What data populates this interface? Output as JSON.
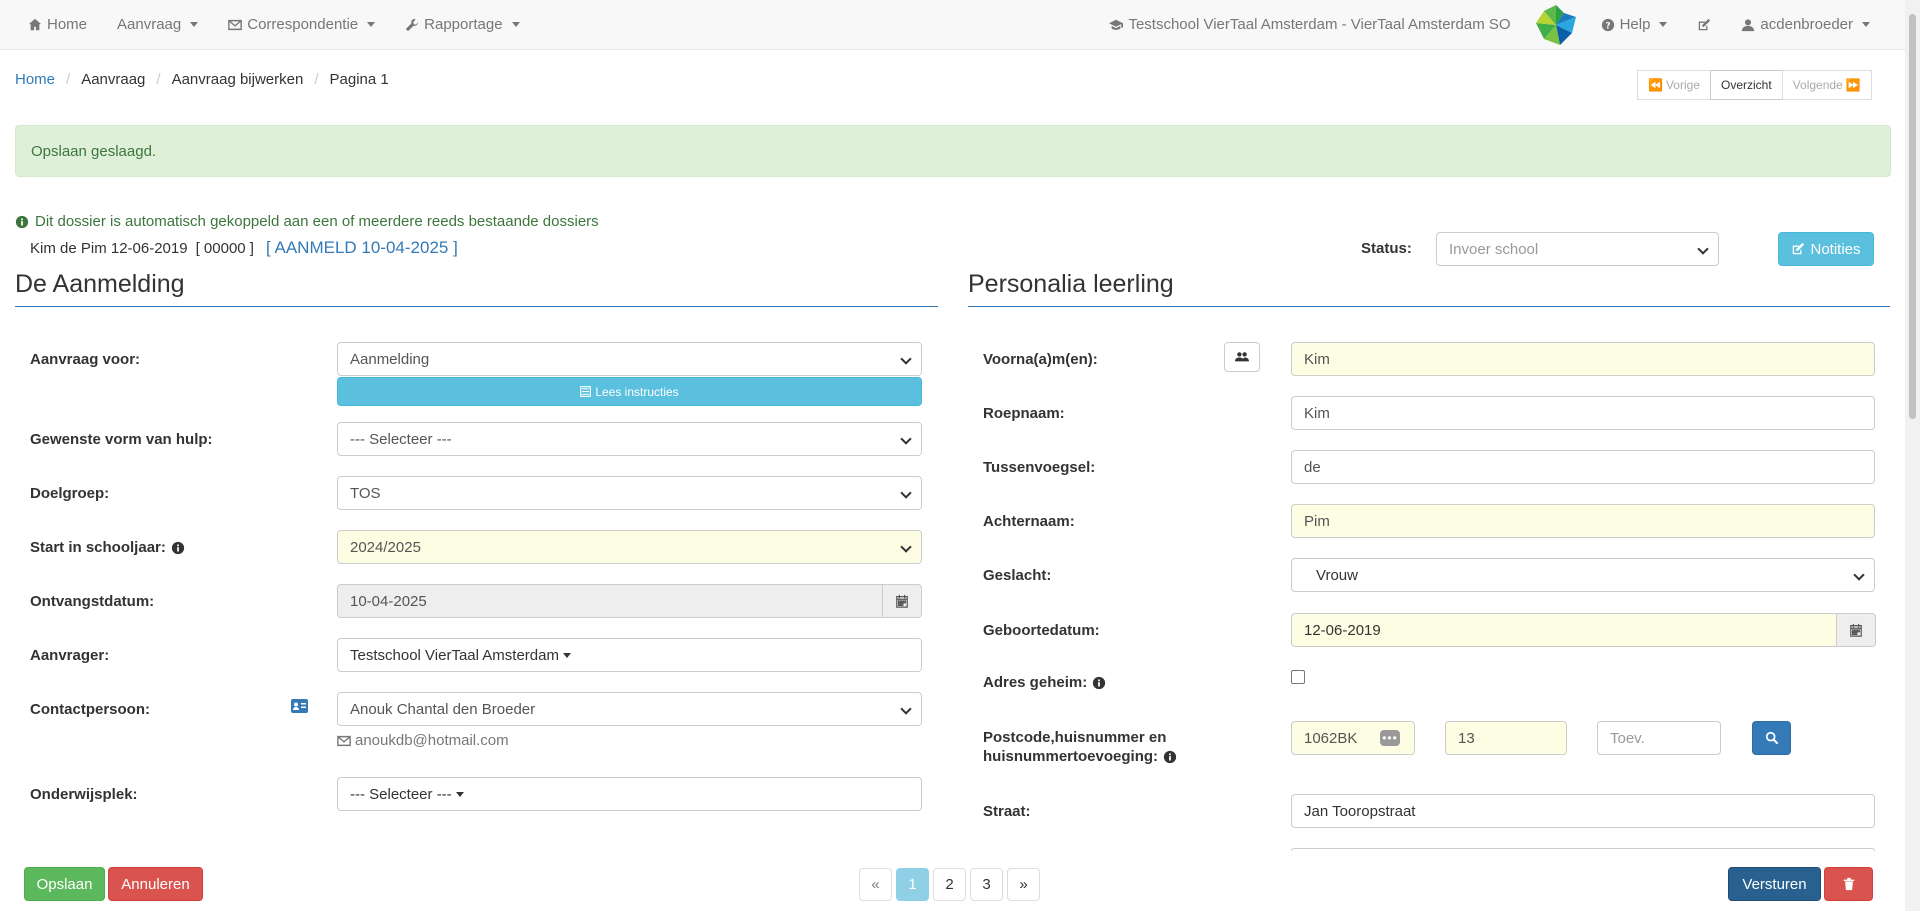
{
  "nav": {
    "home": "Home",
    "aanvraag": "Aanvraag",
    "correspondentie": "Correspondentie",
    "rapportage": "Rapportage",
    "school": "Testschool VierTaal Amsterdam - VierTaal Amsterdam SO",
    "help": "Help",
    "user": "acdenbroeder"
  },
  "breadcrumb": {
    "home": "Home",
    "aanvraag": "Aanvraag",
    "bijwerken": "Aanvraag bijwerken",
    "pagina": "Pagina 1"
  },
  "pager_top": {
    "vorige": "Vorige",
    "overzicht": "Overzicht",
    "volgende": "Volgende"
  },
  "alert_success": "Opslaan geslaagd.",
  "link_notice": "Dit dossier is automatisch gekoppeld aan een of meerdere reeds bestaande dossiers",
  "dossier": {
    "name": "Kim de Pim 12-06-2019",
    "code": "[ 00000 ]",
    "ref": "[ AANMELD 10-04-2025 ]"
  },
  "status": {
    "label": "Status:",
    "value": "Invoer school"
  },
  "notities_label": "Notities",
  "aanmelding": {
    "title": "De Aanmelding",
    "aanvraag_voor": {
      "label": "Aanvraag voor:",
      "value": "Aanmelding"
    },
    "instructies_label": "Lees instructies",
    "vorm_hulp": {
      "label": "Gewenste vorm van hulp:",
      "value": "--- Selecteer ---"
    },
    "doelgroep": {
      "label": "Doelgroep:",
      "value": "TOS"
    },
    "schooljaar": {
      "label": "Start in schooljaar:",
      "value": "2024/2025"
    },
    "ontvangst": {
      "label": "Ontvangstdatum:",
      "value": "10-04-2025"
    },
    "aanvrager": {
      "label": "Aanvrager:",
      "value": "Testschool VierTaal Amsterdam"
    },
    "contact": {
      "label": "Contactpersoon:",
      "value": "Anouk Chantal den Broeder",
      "email": "anoukdb@hotmail.com"
    },
    "onderwijsplek": {
      "label": "Onderwijsplek:",
      "value": "--- Selecteer ---"
    }
  },
  "personalia": {
    "title": "Personalia leerling",
    "voornamen": {
      "label": "Voorna(a)m(en):",
      "value": "Kim"
    },
    "roepnaam": {
      "label": "Roepnaam:",
      "value": "Kim"
    },
    "tussenvoegsel": {
      "label": "Tussenvoegsel:",
      "value": "de"
    },
    "achternaam": {
      "label": "Achternaam:",
      "value": "Pim"
    },
    "geslacht": {
      "label": "Geslacht:",
      "value": "Vrouw"
    },
    "geboortedatum": {
      "label": "Geboortedatum:",
      "value": "12-06-2019"
    },
    "adres_geheim": {
      "label": "Adres geheim:"
    },
    "postcode": {
      "label_1": "Postcode,huisnummer en",
      "label_2": "huisnummertoevoeging:",
      "postcode": "1062BK",
      "huisnummer": "13",
      "toevoeging_placeholder": "Toev."
    },
    "straat": {
      "label": "Straat:",
      "value": "Jan Tooropstraat"
    }
  },
  "footer": {
    "opslaan": "Opslaan",
    "annuleren": "Annuleren",
    "versturen": "Versturen",
    "pages": [
      "«",
      "1",
      "2",
      "3",
      "»"
    ]
  },
  "colors": {
    "primary": "#337ab7",
    "info": "#5bc0de",
    "success": "#5cb85c",
    "danger": "#d9534f",
    "highlight": "#fdfde3"
  }
}
